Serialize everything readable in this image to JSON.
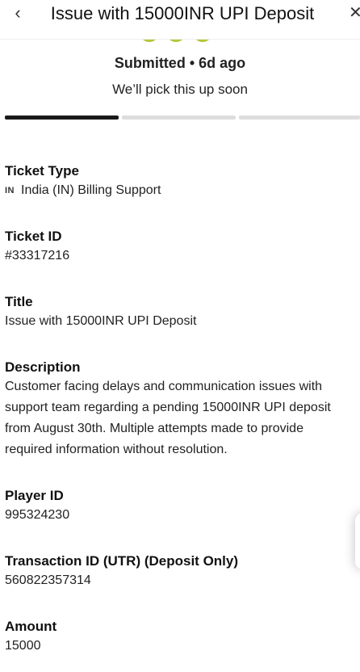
{
  "header": {
    "back_icon": "‹",
    "title": "Issue with 15000INR UPI Deposit",
    "close_icon": "✕"
  },
  "status": {
    "state": "Submitted",
    "separator": "•",
    "age": "6d ago",
    "message": "We’ll pick this up soon",
    "icon_color": "#b5c63a",
    "progress_steps_completed": 1,
    "progress_steps_total": 3
  },
  "fields": {
    "ticket_type": {
      "label": "Ticket Type",
      "badge": "IN",
      "value": "India (IN) Billing Support"
    },
    "ticket_id": {
      "label": "Ticket ID",
      "value": "#33317216"
    },
    "title": {
      "label": "Title",
      "value": "Issue with 15000INR UPI Deposit"
    },
    "description": {
      "label": "Description",
      "value": "Customer facing delays and communication issues with support team regarding a pending 15000INR UPI deposit from August 30th. Multiple attempts made to provide required information without resolution."
    },
    "player_id": {
      "label": "Player ID",
      "value": "995324230"
    },
    "transaction_id": {
      "label": "Transaction ID (UTR) (Deposit Only)",
      "value": "560822357314"
    },
    "amount": {
      "label": "Amount",
      "value": "15000"
    }
  }
}
